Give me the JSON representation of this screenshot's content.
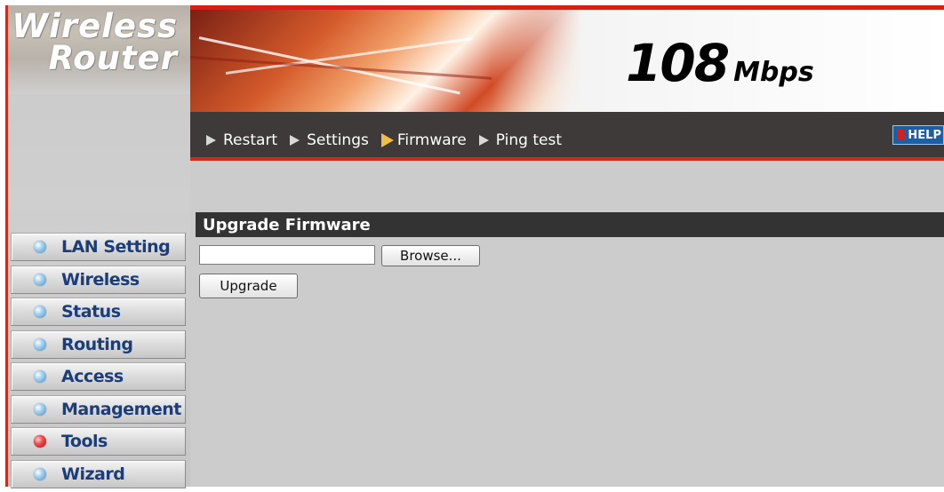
{
  "brand": {
    "line1": "Wireless",
    "line2": "Router"
  },
  "banner": {
    "speed_value": "108",
    "speed_unit": "Mbps"
  },
  "nav": {
    "links": [
      {
        "label": "Restart",
        "active": false
      },
      {
        "label": "Settings",
        "active": false
      },
      {
        "label": "Firmware",
        "active": true
      },
      {
        "label": "Ping test",
        "active": false
      }
    ],
    "help_label": "HELP"
  },
  "menu": {
    "items": [
      {
        "label": "LAN Setting",
        "active": false
      },
      {
        "label": "Wireless",
        "active": false
      },
      {
        "label": "Status",
        "active": false
      },
      {
        "label": "Routing",
        "active": false
      },
      {
        "label": "Access",
        "active": false
      },
      {
        "label": "Management",
        "active": false
      },
      {
        "label": "Tools",
        "active": true
      },
      {
        "label": "Wizard",
        "active": false
      }
    ]
  },
  "content": {
    "section_title": "Upgrade Firmware",
    "file_value": "",
    "browse_label": "Browse...",
    "upgrade_label": "Upgrade"
  },
  "colors": {
    "accent_red": "#cf2a1a",
    "nav_bg": "#3d3a39",
    "content_bg": "#cccccc",
    "menu_text": "#1b3d7a"
  }
}
